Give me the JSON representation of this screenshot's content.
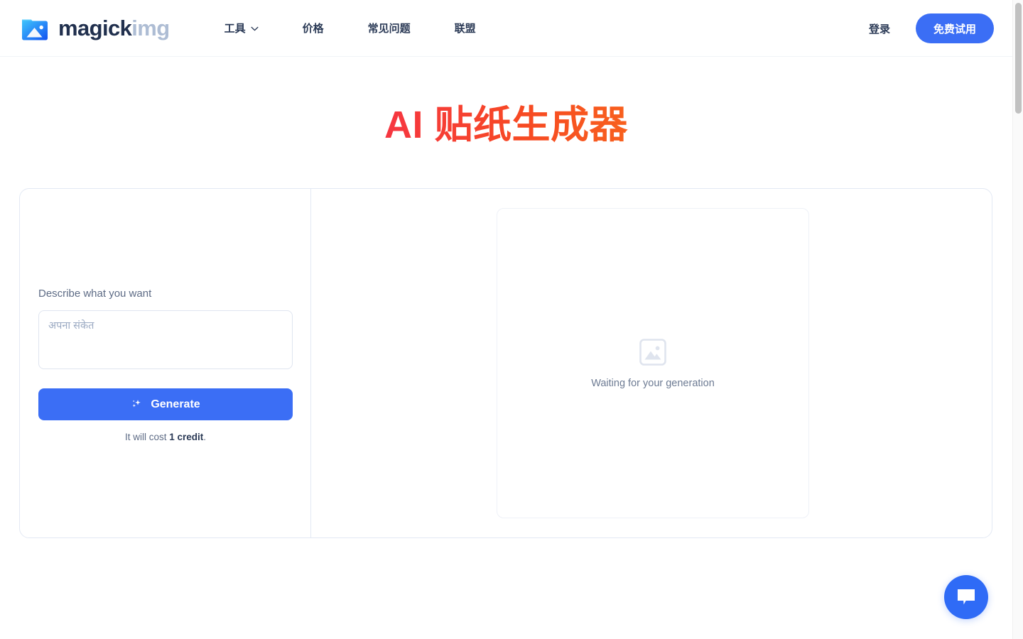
{
  "header": {
    "brand": {
      "icon": "image-folder-logo-icon",
      "name_primary": "magick",
      "name_secondary": "img"
    },
    "nav": [
      {
        "label": "工具",
        "has_chevron": true,
        "icon": "chevron-down-icon"
      },
      {
        "label": "价格",
        "has_chevron": false,
        "icon": ""
      },
      {
        "label": "常见问题",
        "has_chevron": false,
        "icon": ""
      },
      {
        "label": "联盟",
        "has_chevron": false,
        "icon": ""
      }
    ],
    "login_label": "登录",
    "cta_label": "免费试用"
  },
  "page": {
    "title": "AI 贴纸生成器",
    "title_gradient_from": "#ec1e79",
    "title_gradient_to": "#eeae2d"
  },
  "form": {
    "field_label": "Describe what you want",
    "prompt_value": "",
    "prompt_placeholder": "अपना संकेत",
    "generate_label": "Generate",
    "generate_icon": "sparkles-icon",
    "cost_prefix": "It will cost ",
    "cost_amount": "1 credit",
    "cost_suffix": ".",
    "accent_color": "#3b6ef5"
  },
  "preview": {
    "placeholder_icon": "image-placeholder-icon",
    "status_text": "Waiting for your generation"
  },
  "chat": {
    "icon": "chat-bubble-icon",
    "color": "#2f6bf6"
  },
  "scrollbar": {
    "thumb_position": "top"
  }
}
